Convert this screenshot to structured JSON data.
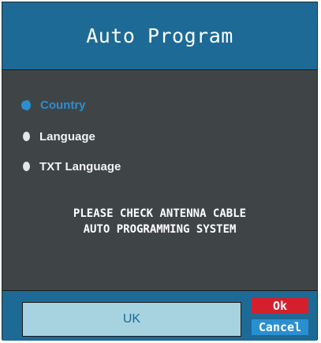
{
  "dialog": {
    "title": "Auto Program",
    "options": [
      {
        "label": "Country",
        "selected": true
      },
      {
        "label": "Language",
        "selected": false
      },
      {
        "label": "TXT Language",
        "selected": false
      }
    ],
    "message_lines": [
      "PLEASE CHECK ANTENNA CABLE",
      "AUTO PROGRAMMING SYSTEM"
    ],
    "value": "UK",
    "ok_label": "Ok",
    "cancel_label": "Cancel"
  },
  "colors": {
    "header_blue": "#1d6a96",
    "panel_gray": "#3f4447",
    "selected_blue": "#2a8fd0",
    "ok_red": "#d61f2c",
    "value_field": "#a6d3df"
  },
  "icons": {
    "radio_selected": "radio-selected-icon",
    "radio_unselected": "radio-unselected-icon"
  }
}
